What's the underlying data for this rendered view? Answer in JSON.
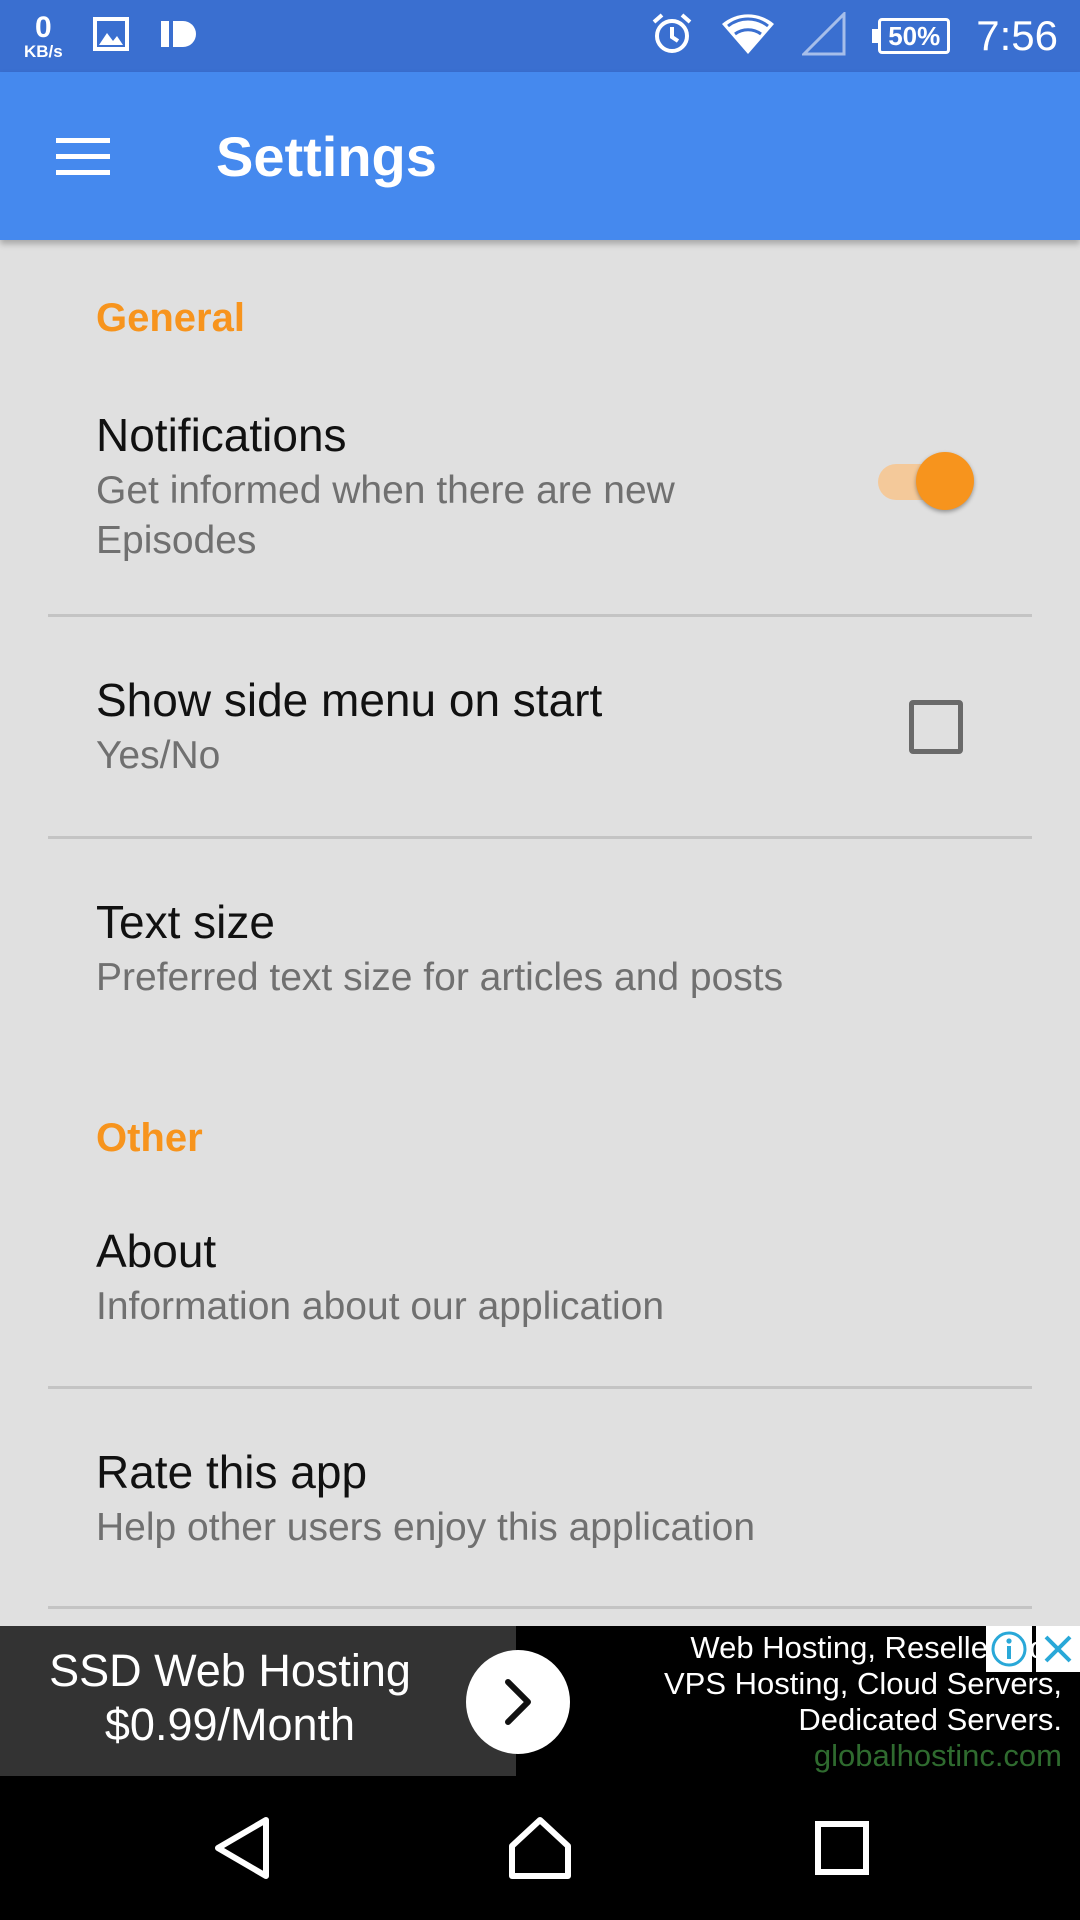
{
  "status_bar": {
    "net_speed_value": "0",
    "net_speed_unit": "KB/s",
    "battery_percent": "50%",
    "time": "7:56",
    "icons": [
      "image-icon",
      "id-icon",
      "alarm-icon",
      "wifi-icon",
      "signal-icon",
      "battery-icon"
    ]
  },
  "app_bar": {
    "title": "Settings",
    "menu_icon": "hamburger-menu-icon"
  },
  "sections": {
    "general": {
      "header": "General"
    },
    "other": {
      "header": "Other"
    }
  },
  "prefs": {
    "notifications": {
      "title": "Notifications",
      "summary": "Get informed when there are new Episodes",
      "enabled": true
    },
    "side_menu": {
      "title": "Show side menu on start",
      "summary": "Yes/No",
      "checked": false
    },
    "text_size": {
      "title": "Text size",
      "summary": "Preferred text size for articles and posts"
    },
    "about": {
      "title": "About",
      "summary": "Information about our application"
    },
    "rate": {
      "title": "Rate this app",
      "summary": "Help other users enjoy this application"
    }
  },
  "ad": {
    "headline_line1": "SSD Web Hosting",
    "headline_line2": "$0.99/Month",
    "desc_line1": "Web Hosting, Reseller Hos",
    "desc_line2": "VPS Hosting, Cloud Servers,",
    "desc_line3": "Dedicated Servers.",
    "domain": "globalhostinc.com"
  },
  "colors": {
    "status_bar": "#3a6fd0",
    "app_bar": "#4589ee",
    "accent": "#f7941d",
    "background": "#e0e0e0"
  }
}
